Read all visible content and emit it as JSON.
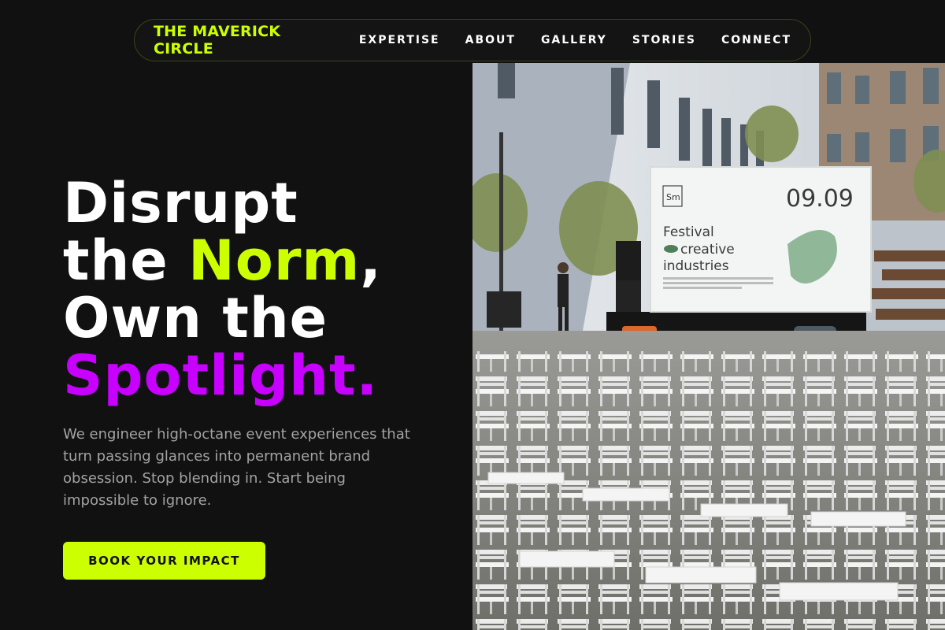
{
  "nav": {
    "brand": "THE MAVERICK CIRCLE",
    "links": [
      "EXPERTISE",
      "ABOUT",
      "GALLERY",
      "STORIES",
      "CONNECT"
    ]
  },
  "hero": {
    "line1": "Disrupt",
    "line2_a": "the ",
    "line2_b": "Norm",
    "line2_c": ",",
    "line3": "Own the",
    "line4": "Spotlight.",
    "subtext": "We engineer high-octane event experiences that turn passing glances into permanent brand obsession. Stop blending in. Start being impossible to ignore.",
    "cta": "BOOK YOUR IMPACT"
  },
  "photo": {
    "screen_logo": "Sm",
    "screen_date": "09.09",
    "screen_title_1": "Festival",
    "screen_title_2": "creative",
    "screen_title_3": "industries"
  },
  "colors": {
    "background": "#111112",
    "accent_lime": "#ccff00",
    "accent_purple": "#c800ff",
    "muted_text": "#a3a3a3"
  }
}
